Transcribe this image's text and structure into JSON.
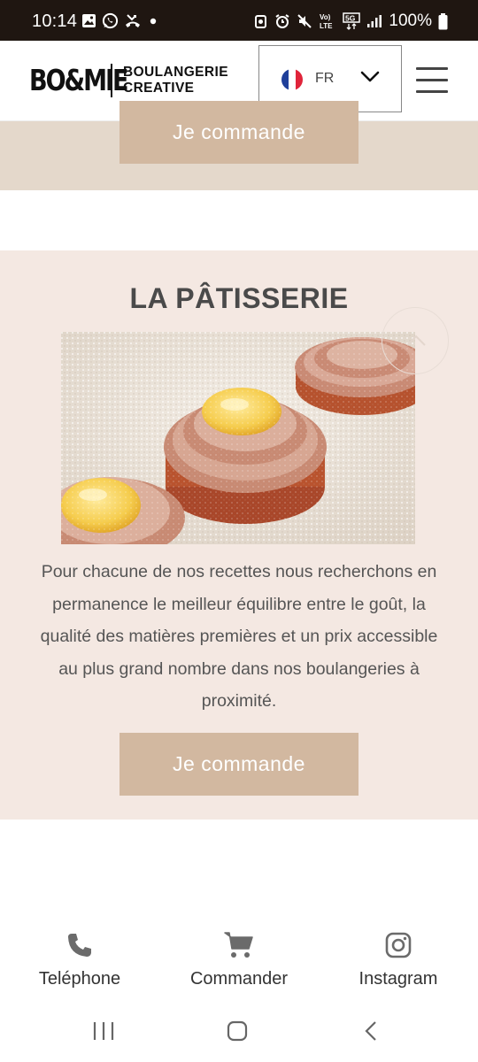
{
  "status_bar": {
    "time": "10:14",
    "battery": "100%",
    "icons": [
      "gallery-icon",
      "whatsapp-icon",
      "missed-call-icon",
      "dot-icon",
      "alarm-icon",
      "mute-icon",
      "volte-icon",
      "5g-icon",
      "signal-icon",
      "battery-icon"
    ],
    "vo_label": "Vo) LTE",
    "net_label": "5G"
  },
  "header": {
    "logo_mark": "BO&MIE",
    "logo_line1": "BOULANGERIE",
    "logo_line2": "CREATIVE",
    "language": "FR",
    "flag_colors": [
      "#1f3f9a",
      "#ffffff",
      "#e0243a"
    ]
  },
  "previous_section": {
    "button_label": "Je commande"
  },
  "pastry_section": {
    "title": "LA PÂTISSERIE",
    "description": "Pour chacune de nos recettes nous recherchons en permanence le meilleur équilibre entre le goût, la qualité des matières premières et un prix accessible au plus grand nombre dans nos boulangeries à proximité.",
    "button_label": "Je commande"
  },
  "bottom_nav": {
    "items": [
      {
        "label": "Teléphone",
        "icon": "phone-icon"
      },
      {
        "label": "Commander",
        "icon": "cart-icon"
      },
      {
        "label": "Instagram",
        "icon": "instagram-icon"
      }
    ]
  },
  "colors": {
    "button": "#d2b8a0",
    "section_bg": "#f4e8e2",
    "prev_section_bg": "#e4d8cb",
    "status_bar": "#1f1611",
    "icon": "#6b6b6b"
  }
}
